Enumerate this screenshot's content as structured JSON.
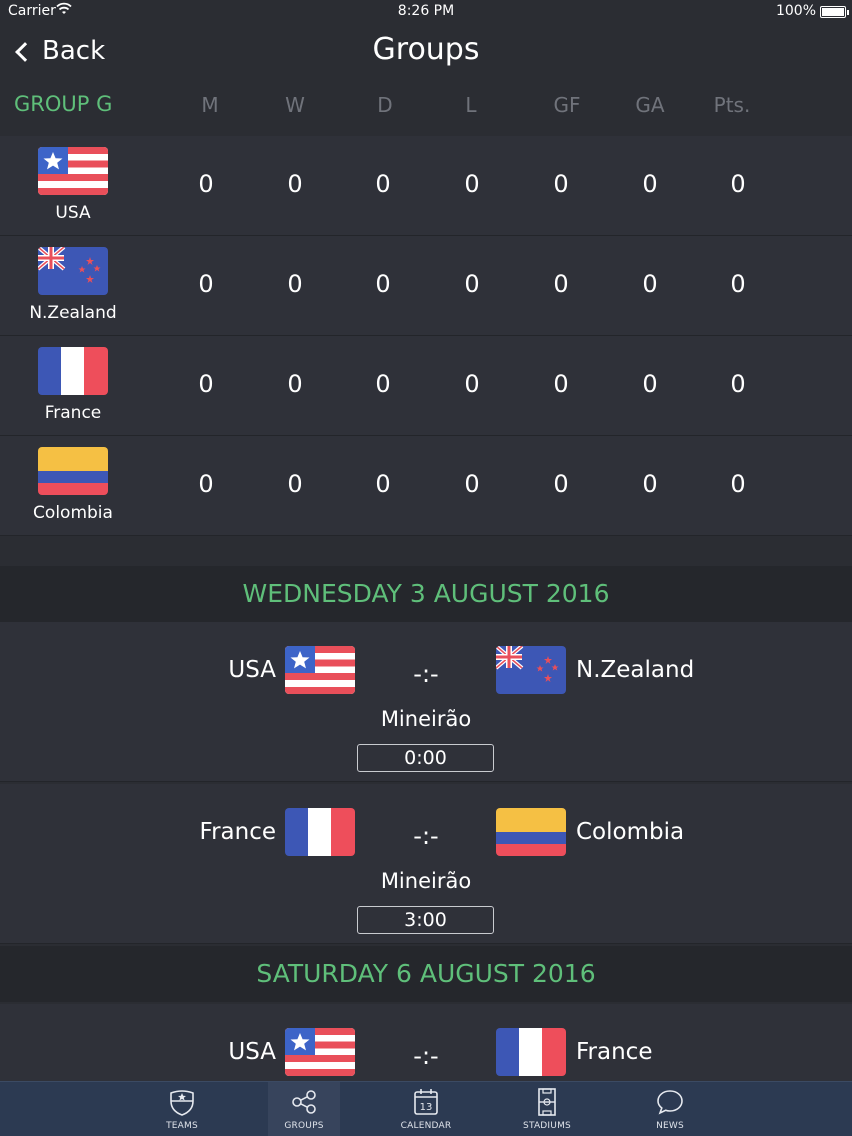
{
  "status_bar": {
    "carrier": "Carrier",
    "time": "8:26 PM",
    "battery": "100%"
  },
  "nav": {
    "back_label": "Back",
    "title": "Groups"
  },
  "group": {
    "name": "GROUP G",
    "columns": [
      "M",
      "W",
      "D",
      "L",
      "GF",
      "GA",
      "Pts."
    ]
  },
  "standings": [
    {
      "team": "USA",
      "flag": "usa-flag-icon",
      "stats": [
        "0",
        "0",
        "0",
        "0",
        "0",
        "0",
        "0"
      ]
    },
    {
      "team": "N.Zealand",
      "flag": "new-zealand-flag-icon",
      "stats": [
        "0",
        "0",
        "0",
        "0",
        "0",
        "0",
        "0"
      ]
    },
    {
      "team": "France",
      "flag": "france-flag-icon",
      "stats": [
        "0",
        "0",
        "0",
        "0",
        "0",
        "0",
        "0"
      ]
    },
    {
      "team": "Colombia",
      "flag": "colombia-flag-icon",
      "stats": [
        "0",
        "0",
        "0",
        "0",
        "0",
        "0",
        "0"
      ]
    }
  ],
  "schedule": [
    {
      "date": "WEDNESDAY 3 AUGUST 2016",
      "matches": [
        {
          "home": "USA",
          "away": "N.Zealand",
          "score": "-:-",
          "stadium": "Mineirão",
          "kickoff": "0:00"
        },
        {
          "home": "France",
          "away": "Colombia",
          "score": "-:-",
          "stadium": "Mineirão",
          "kickoff": "3:00"
        }
      ]
    },
    {
      "date": "SATURDAY 6 AUGUST 2016",
      "matches": [
        {
          "home": "USA",
          "away": "France",
          "score": "-:-"
        }
      ]
    }
  ],
  "tabs": [
    {
      "label": "TEAMS",
      "icon": "shield-icon"
    },
    {
      "label": "GROUPS",
      "icon": "share-nodes-icon",
      "active": true
    },
    {
      "label": "CALENDAR",
      "icon": "calendar-icon",
      "day": "13"
    },
    {
      "label": "STADIUMS",
      "icon": "pitch-icon"
    },
    {
      "label": "NEWS",
      "icon": "speech-bubble-icon"
    }
  ],
  "colors": {
    "accent_green": "#5fbf7a",
    "background": "#2b2d33",
    "row": "#2f3139",
    "tab_bar": "#2c3a52"
  }
}
